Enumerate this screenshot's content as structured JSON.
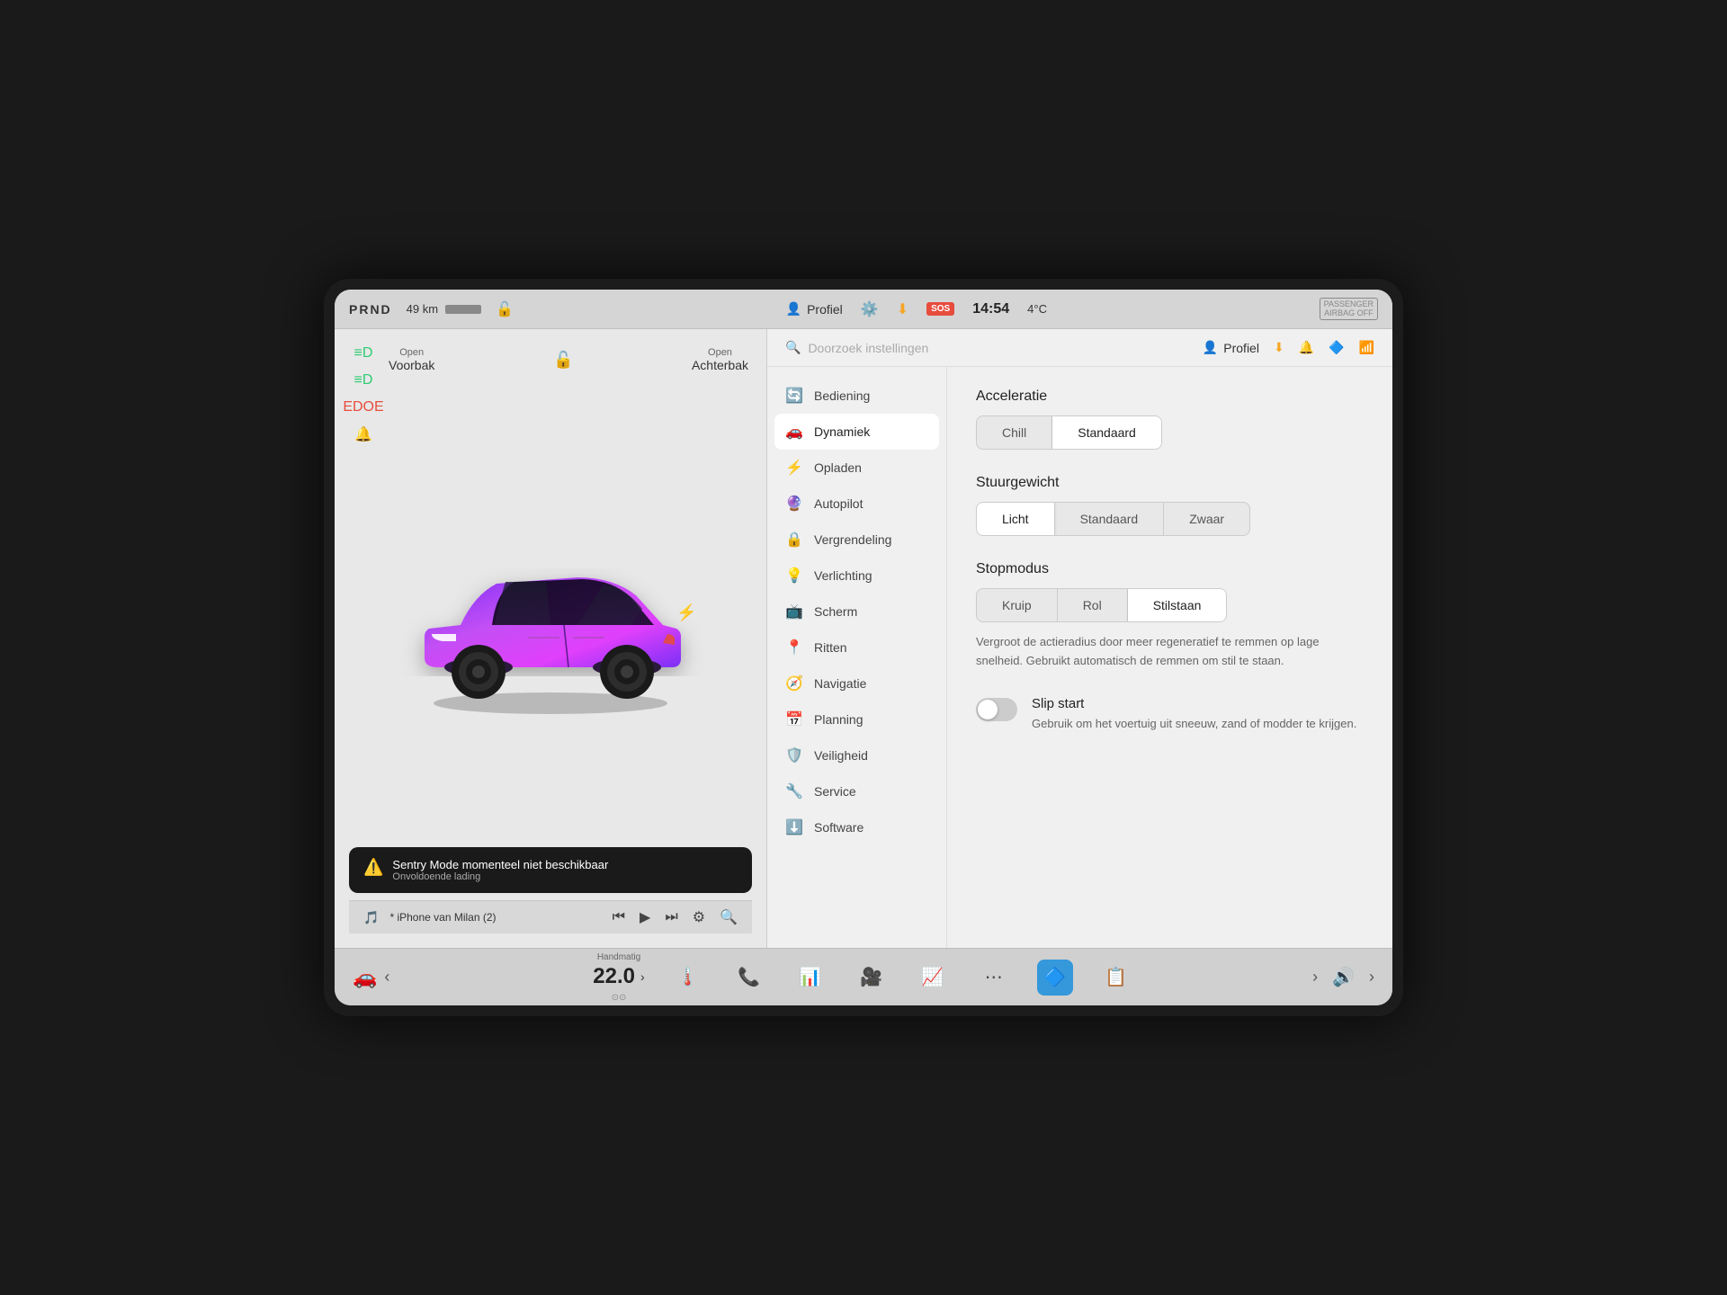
{
  "topbar": {
    "prnd": "PRND",
    "range": "49 km",
    "profile_label": "Profiel",
    "time": "14:54",
    "temp": "4°C",
    "sos": "SOS",
    "passenger_airbag_line1": "PASSENGER",
    "passenger_airbag_line2": "AIRBAG OFF"
  },
  "car_panel": {
    "front_hood_label_small": "Open",
    "front_hood_label_main": "Voorbak",
    "rear_trunk_label_small": "Open",
    "rear_trunk_label_main": "Achterbak",
    "sentry_title": "Sentry Mode momenteel niet beschikbaar",
    "sentry_subtitle": "Onvoldoende lading"
  },
  "music_bar": {
    "device": "* iPhone van Milan (2)"
  },
  "settings": {
    "search_placeholder": "Doorzoek instellingen",
    "profile_label": "Profiel",
    "sidebar": [
      {
        "icon": "🔄",
        "label": "Bediening",
        "active": false
      },
      {
        "icon": "🚗",
        "label": "Dynamiek",
        "active": true
      },
      {
        "icon": "⚡",
        "label": "Opladen",
        "active": false
      },
      {
        "icon": "🔮",
        "label": "Autopilot",
        "active": false
      },
      {
        "icon": "🔒",
        "label": "Vergrendeling",
        "active": false
      },
      {
        "icon": "💡",
        "label": "Verlichting",
        "active": false
      },
      {
        "icon": "📺",
        "label": "Scherm",
        "active": false
      },
      {
        "icon": "📍",
        "label": "Ritten",
        "active": false
      },
      {
        "icon": "🧭",
        "label": "Navigatie",
        "active": false
      },
      {
        "icon": "📅",
        "label": "Planning",
        "active": false
      },
      {
        "icon": "🛡️",
        "label": "Veiligheid",
        "active": false
      },
      {
        "icon": "🔧",
        "label": "Service",
        "active": false
      },
      {
        "icon": "⬇️",
        "label": "Software",
        "active": false
      }
    ],
    "detail": {
      "acceleration_title": "Acceleratie",
      "acceleration_options": [
        "Chill",
        "Standaard"
      ],
      "acceleration_active": "Standaard",
      "steering_title": "Stuurgewicht",
      "steering_options": [
        "Licht",
        "Standaard",
        "Zwaar"
      ],
      "steering_active": "Licht",
      "stopmode_title": "Stopmodus",
      "stopmode_options": [
        "Kruip",
        "Rol",
        "Stilstaan"
      ],
      "stopmode_active": "Stilstaan",
      "stopmode_description": "Vergroot de actieradius door meer regeneratief te remmen op lage snelheid. Gebruikt automatisch de remmen om stil te staan.",
      "slip_start_title": "Slip start",
      "slip_start_description": "Gebruik om het voertuig uit sneeuw, zand of modder te krijgen.",
      "slip_start_enabled": false
    }
  },
  "taskbar": {
    "mode_label": "Handmatig",
    "speed": "22.0",
    "speed_unit": "",
    "icons": [
      "🚗",
      "🌡️",
      "📞",
      "📊",
      "🎥",
      "📈",
      "⋯",
      "🔵",
      "📋"
    ]
  }
}
